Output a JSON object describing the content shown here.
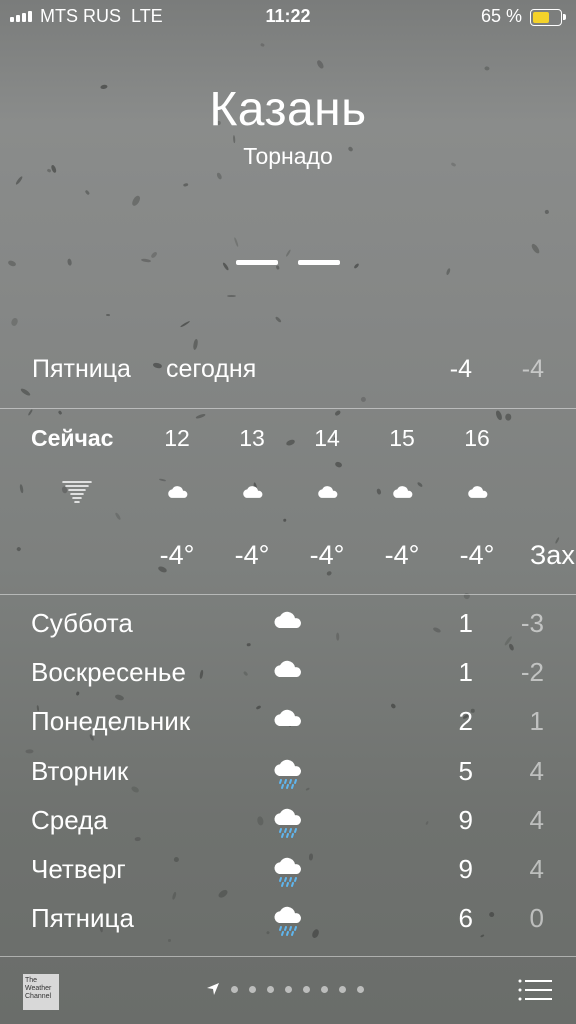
{
  "status_bar": {
    "carrier": "MTS RUS",
    "network": "LTE",
    "time": "11:22",
    "battery_percent": "65 %",
    "battery_level": 0.65,
    "battery_color": "#f4d22a"
  },
  "location": {
    "city": "Казань",
    "condition": "Торнадо",
    "current_temp_display": "— —"
  },
  "today": {
    "day": "Пятница",
    "relative": "сегодня",
    "high": "-4",
    "low": "-4"
  },
  "hourly": [
    {
      "time": "Сейчас",
      "icon": "tornado-icon",
      "temp": ""
    },
    {
      "time": "12",
      "icon": "cloud-icon",
      "temp": "-4°"
    },
    {
      "time": "13",
      "icon": "cloud-icon",
      "temp": "-4°"
    },
    {
      "time": "14",
      "icon": "cloud-icon",
      "temp": "-4°"
    },
    {
      "time": "15",
      "icon": "cloud-icon",
      "temp": "-4°"
    },
    {
      "time": "16",
      "icon": "cloud-icon",
      "temp": "-4°"
    },
    {
      "time": "",
      "icon": "",
      "temp": "Зах"
    }
  ],
  "daily": [
    {
      "day": "Суббота",
      "icon": "cloud-icon",
      "high": "1",
      "low": "-3"
    },
    {
      "day": "Воскресенье",
      "icon": "cloud-icon",
      "high": "1",
      "low": "-2"
    },
    {
      "day": "Понедельник",
      "icon": "cloud-icon",
      "high": "2",
      "low": "1"
    },
    {
      "day": "Вторник",
      "icon": "cloud-rain-icon",
      "high": "5",
      "low": "4"
    },
    {
      "day": "Среда",
      "icon": "cloud-rain-icon",
      "high": "9",
      "low": "4"
    },
    {
      "day": "Четверг",
      "icon": "cloud-rain-icon",
      "high": "9",
      "low": "4"
    },
    {
      "day": "Пятница",
      "icon": "cloud-rain-icon",
      "high": "6",
      "low": "0"
    }
  ],
  "footer": {
    "logo_text": "The Weather Channel",
    "page_count": 8,
    "current_page": 0,
    "rain_color": "#5fb6ef"
  }
}
